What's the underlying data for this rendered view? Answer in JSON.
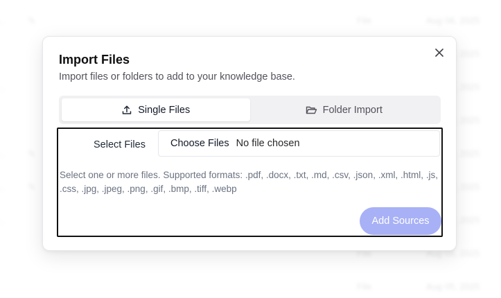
{
  "background": {
    "rows": [
      {
        "name": "...",
        "type": "File",
        "date": "Aug 06, 2025"
      },
      {
        "name": "",
        "type": "",
        "date": "Aug 06, 2025"
      },
      {
        "name": "...",
        "type": "",
        "date": "Aug 06, 2025"
      },
      {
        "name": "",
        "type": "",
        "date": "Aug 06, 2025"
      },
      {
        "name": "...",
        "type": "",
        "date": "Aug 06, 2025"
      },
      {
        "name": "...",
        "type": "",
        "date": "Aug 06, 2025"
      },
      {
        "name": "...",
        "type": "",
        "date": "Aug 06, 2025"
      },
      {
        "name": "",
        "type": "File",
        "date": "Aug 05, 2025"
      },
      {
        "name": "",
        "type": "File",
        "date": "Aug 05, 2025"
      }
    ]
  },
  "dialog": {
    "title": "Import Files",
    "description": "Import files or folders to add to your knowledge base.",
    "close_icon": "close-icon",
    "tabs": [
      {
        "label": "Single Files",
        "icon": "upload-icon",
        "active": true
      },
      {
        "label": "Folder Import",
        "icon": "folder-open-icon",
        "active": false
      }
    ],
    "form": {
      "field_label": "Select Files",
      "choose_button_label": "Choose Files",
      "file_status": "No file chosen",
      "help_text": "Select one or more files. Supported formats: .pdf, .docx, .txt, .md, .csv, .json, .xml, .html, .js, .css, .jpg, .jpeg, .png, .gif, .bmp, .tiff, .webp",
      "submit_label": "Add Sources"
    },
    "colors": {
      "submit_disabled": "#a8b1f6",
      "tabs_background": "#f1f1f3"
    }
  }
}
